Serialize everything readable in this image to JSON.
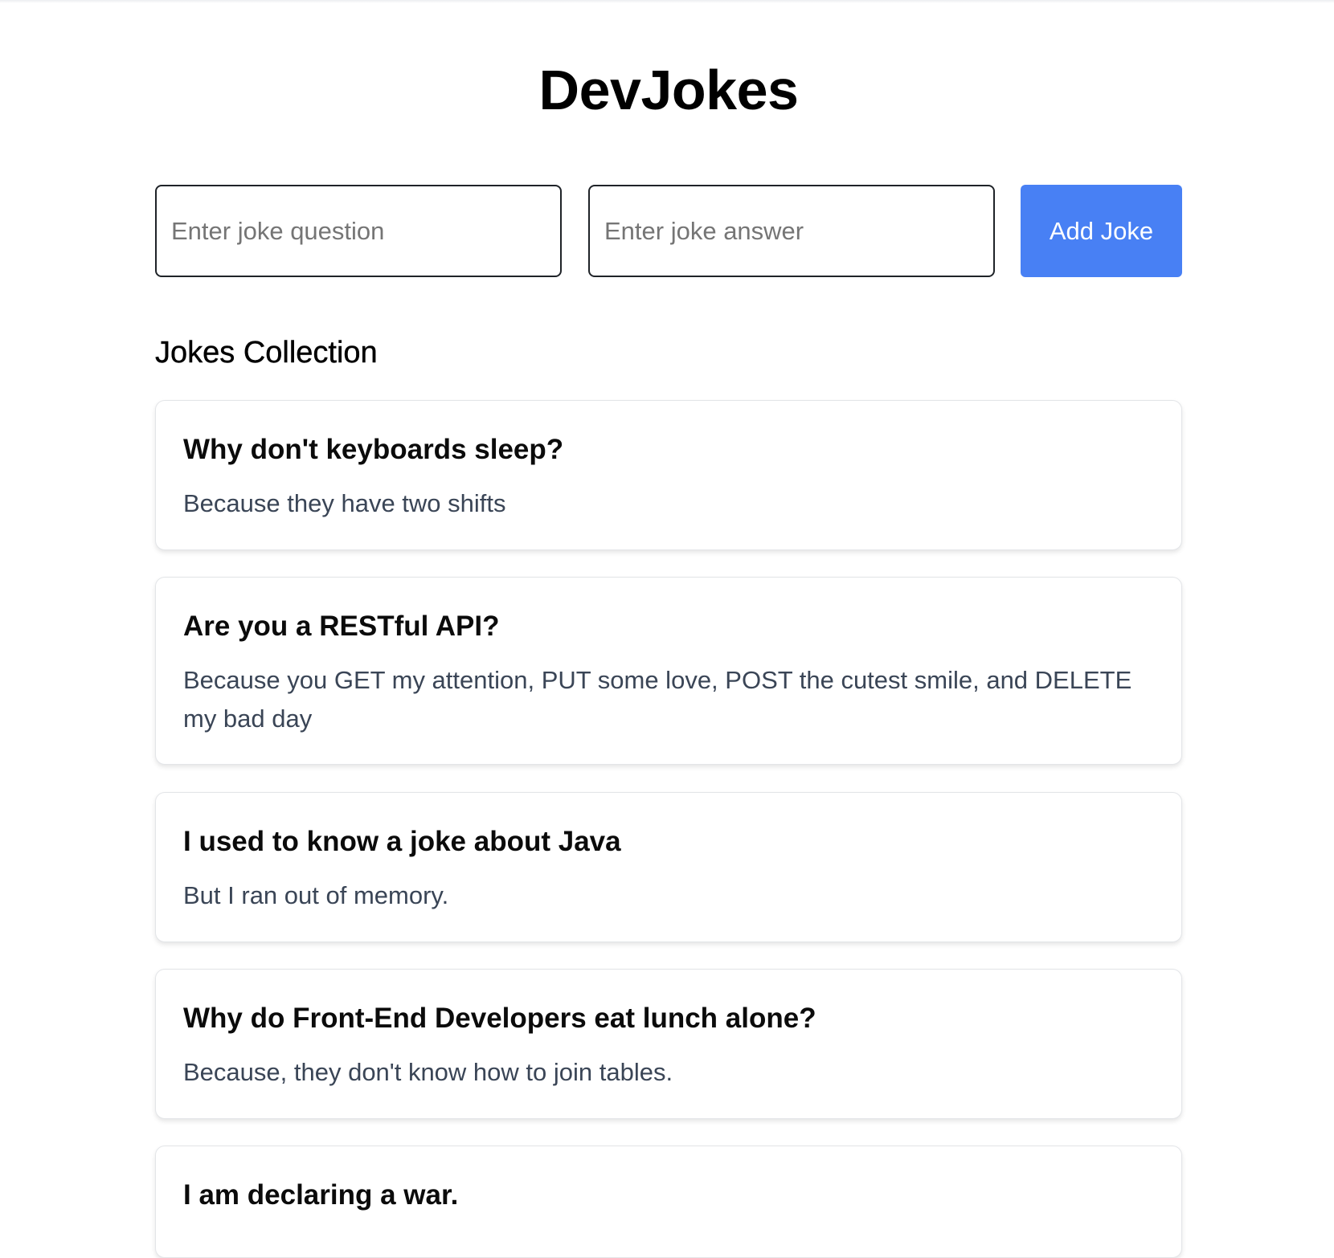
{
  "app": {
    "title": "DevJokes"
  },
  "form": {
    "question_placeholder": "Enter joke question",
    "answer_placeholder": "Enter joke answer",
    "add_button_label": "Add Joke",
    "accent_color": "#4880f4"
  },
  "collection": {
    "title": "Jokes Collection",
    "jokes": [
      {
        "question": "Why don't keyboards sleep?",
        "answer": "Because they have two shifts"
      },
      {
        "question": "Are you a RESTful API?",
        "answer": "Because you GET my attention, PUT some love, POST the cutest smile, and DELETE my bad day"
      },
      {
        "question": "I used to know a joke about Java",
        "answer": "But I ran out of memory."
      },
      {
        "question": "Why do Front-End Developers eat lunch alone?",
        "answer": "Because, they don't know how to join tables."
      },
      {
        "question": "I am declaring a war.",
        "answer": ""
      }
    ]
  }
}
